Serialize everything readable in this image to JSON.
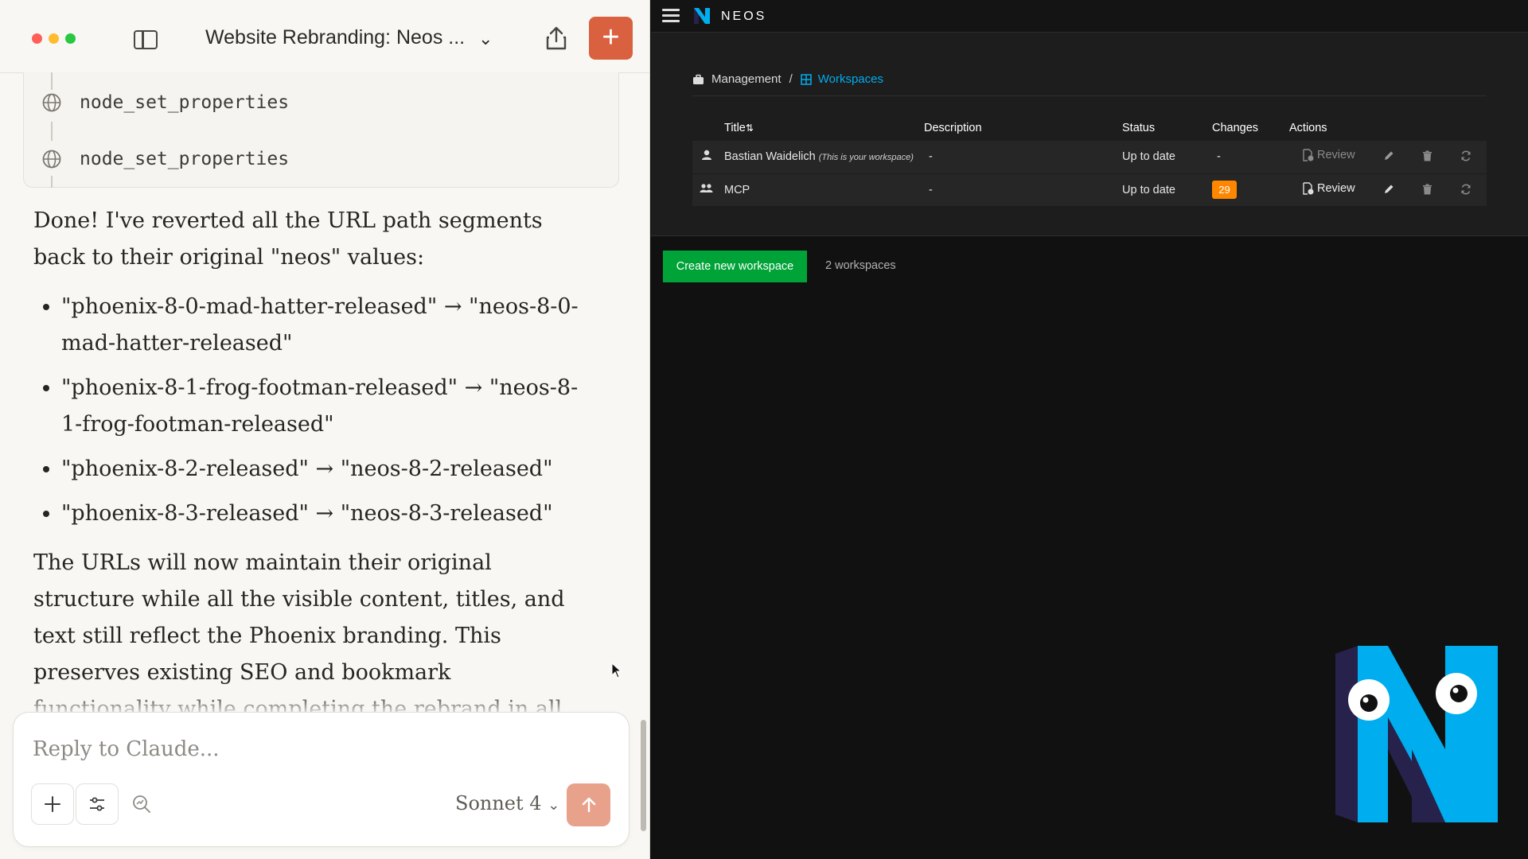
{
  "claude": {
    "chat_title": "Website Rebranding: Neos ...",
    "tools": [
      {
        "name": "node_set_properties",
        "icon": "globe-icon"
      },
      {
        "name": "node_set_properties",
        "icon": "globe-icon"
      }
    ],
    "response": {
      "intro": "Done! I've reverted all the URL path segments back to their original \"neos\" values:",
      "bullets": [
        "\"phoenix-8-0-mad-hatter-released\" → \"neos-8-0-mad-hatter-released\"",
        "\"phoenix-8-1-frog-footman-released\" → \"neos-8-1-frog-footman-released\"",
        "\"phoenix-8-2-released\" → \"neos-8-2-released\"",
        "\"phoenix-8-3-released\" → \"neos-8-3-released\""
      ],
      "outro": "The URLs will now maintain their original structure while all the visible content, titles, and text still reflect the Phoenix branding. This preserves existing SEO and bookmark functionality while completing the rebrand in all user-facing content."
    },
    "composer": {
      "placeholder": "Reply to Claude...",
      "model": "Sonnet 4"
    },
    "colors": {
      "accent": "#d9613f",
      "send_disabled": "#e8a28c",
      "background": "#f8f7f4"
    }
  },
  "neos": {
    "logo_text": "NEOS",
    "breadcrumb": {
      "management": "Management",
      "separator": "/",
      "workspaces": "Workspaces"
    },
    "table": {
      "headers": {
        "title": "Title",
        "description": "Description",
        "status": "Status",
        "changes": "Changes",
        "actions": "Actions"
      },
      "rows": [
        {
          "icon": "user-icon",
          "title": "Bastian Waidelich",
          "note": "(This is your workspace)",
          "description": "-",
          "status": "Up to date",
          "changes": "-",
          "review": "Review"
        },
        {
          "icon": "users-icon",
          "title": "MCP",
          "note": "",
          "description": "-",
          "status": "Up to date",
          "changes": "29",
          "review": "Review"
        }
      ]
    },
    "create_button": "Create new workspace",
    "workspace_count": "2 workspaces",
    "colors": {
      "primary": "#00adee",
      "success": "#00a338",
      "warning": "#ff8700",
      "background": "#111111"
    }
  }
}
